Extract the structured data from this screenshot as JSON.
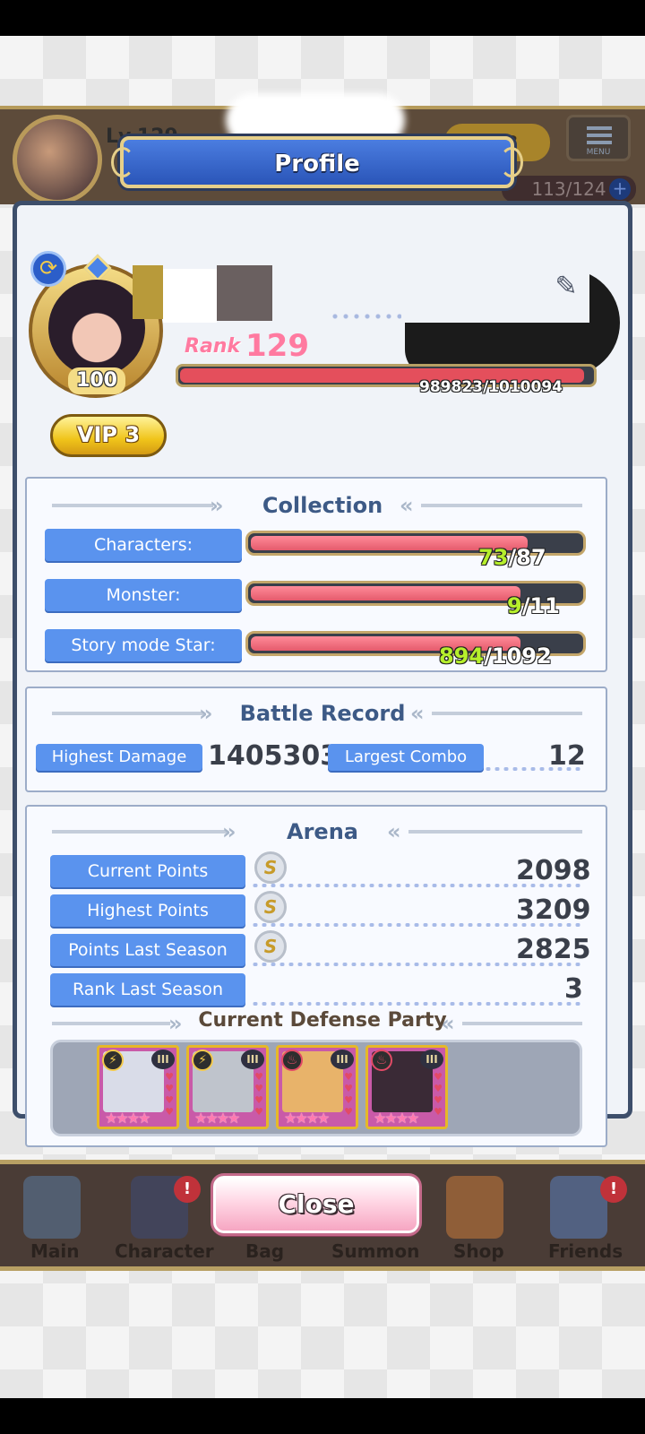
{
  "hud": {
    "level": "Lv.129",
    "vip": "VIP3",
    "menu_label": "MENU",
    "stamina": "113/124"
  },
  "modal": {
    "title": "Profile"
  },
  "profile": {
    "avatar_level": "100",
    "rank_label": "Rank",
    "rank_value": "129",
    "exp_text": "989823/1010094",
    "exp_progress": 0.98,
    "vip_label": "VIP 3"
  },
  "collection": {
    "title": "Collection",
    "rows": [
      {
        "label": "Characters:",
        "current": "73",
        "total": "/87",
        "progress": 0.839
      },
      {
        "label": "Monster:",
        "current": "9",
        "total": "/11",
        "progress": 0.818
      },
      {
        "label": "Story mode Star:",
        "current": "894",
        "total": "/1092",
        "progress": 0.819
      }
    ]
  },
  "battle_record": {
    "title": "Battle Record",
    "highest_damage_label": "Highest Damage",
    "highest_damage_value": "1405303",
    "largest_combo_label": "Largest Combo",
    "largest_combo_value": "12"
  },
  "arena": {
    "title": "Arena",
    "rows": [
      {
        "label": "Current Points",
        "value": "2098",
        "has_icon": true
      },
      {
        "label": "Highest Points",
        "value": "3209",
        "has_icon": true
      },
      {
        "label": "Points Last Season",
        "value": "2825",
        "has_icon": true
      },
      {
        "label": "Rank Last Season",
        "value": "3",
        "has_icon": false
      }
    ],
    "coin_icon_text": "S",
    "defense_title": "Current Defense Party",
    "party": [
      {
        "element": "⚡",
        "tier": "III",
        "stars": "★★★★",
        "portrait_color": "#d9dce8"
      },
      {
        "element": "⚡",
        "tier": "III",
        "stars": "★★★★",
        "portrait_color": "#bfc4cc"
      },
      {
        "element": "♨",
        "tier": "III",
        "stars": "★★★★",
        "portrait_color": "#e8b36a"
      },
      {
        "element": "♨",
        "tier": "III",
        "stars": "★★★★",
        "portrait_color": "#3a2a36"
      }
    ]
  },
  "close_label": "Close",
  "bottom_nav": [
    "Main",
    "Character",
    "Bag",
    "Summon",
    "Shop",
    "Friends"
  ],
  "badge_text": "!"
}
